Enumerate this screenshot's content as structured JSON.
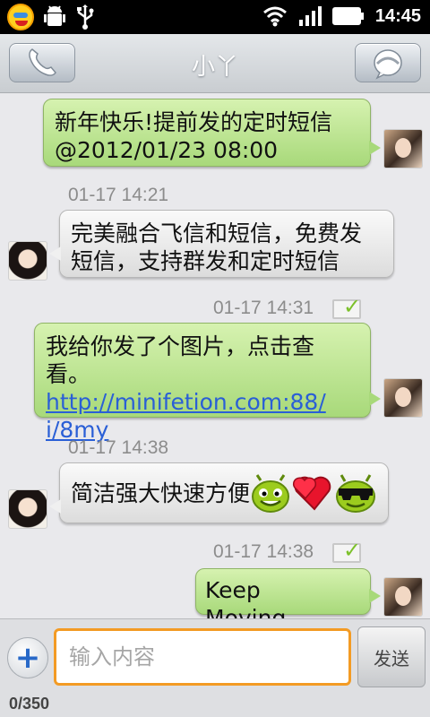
{
  "status_bar": {
    "time": "14:45",
    "left_icons": [
      "fetion-app-icon",
      "android-debug-icon",
      "usb-icon"
    ],
    "right_icons": [
      "wifi-icon",
      "signal-icon",
      "battery-icon"
    ]
  },
  "header": {
    "title": "小丫",
    "left_button": "phone-icon",
    "right_button": "contact-icon"
  },
  "messages": [
    {
      "side": "right",
      "text": "新年快乐!提前发的定时短信\n@2012/01/23 08:00"
    },
    {
      "side": "left",
      "timestamp": "01-17 14:21",
      "text": "完美融合飞信和短信，免费发\n短信，支持群发和定时短信"
    },
    {
      "side": "right",
      "timestamp": "01-17 14:31",
      "text_prefix": "我给你发了个图片，点击查\n看。 ",
      "link": "http://minifetion.com:88/\ni/8my"
    },
    {
      "side": "left",
      "timestamp": "01-17 14:38",
      "text": "简洁强大快速方便",
      "emoticons": [
        "android-smile-icon",
        "hearts-icon",
        "android-sunglasses-icon"
      ]
    },
    {
      "side": "right",
      "timestamp": "01-17 14:38",
      "text": "Keep Moving..."
    }
  ],
  "composer": {
    "placeholder": "输入内容",
    "send_label": "发送",
    "counter": "0/350"
  },
  "colors": {
    "outgoing_bubble": "#b9e38e",
    "incoming_bubble": "#eeeeee",
    "input_focus": "#f39b24",
    "link": "#2a5fd6"
  }
}
